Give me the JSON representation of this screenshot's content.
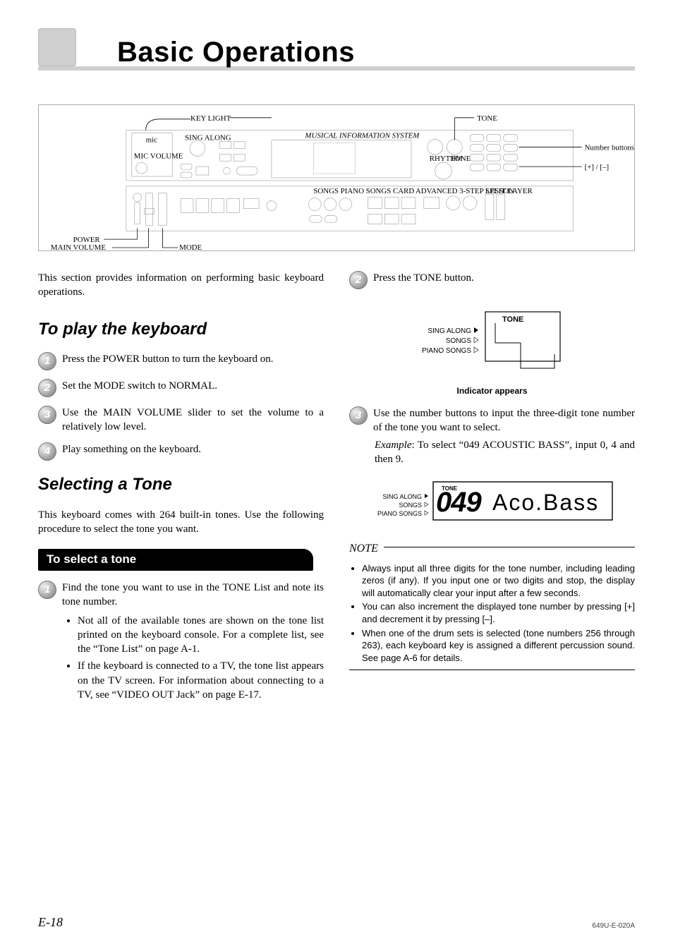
{
  "title": "Basic Operations",
  "intro": "This section provides information on performing basic keyboard operations.",
  "sections": {
    "playKeyboard": {
      "heading": "To play the keyboard",
      "steps": [
        "Press the POWER button to turn the keyboard on.",
        "Set the MODE switch to NORMAL.",
        "Use the MAIN VOLUME slider to set the volume to a relatively low level.",
        "Play something on the keyboard."
      ]
    },
    "selectingTone": {
      "heading": "Selecting a Tone",
      "intro": "This keyboard comes with 264 built-in tones. Use the following procedure to select the tone you want.",
      "subhead": "To select a tone",
      "step1": "Find the tone you want to use in the TONE List and note its tone number.",
      "step1_bullets": [
        "Not all of the available tones are shown on the tone list printed on the keyboard console. For a complete list, see the “Tone List” on page A-1.",
        "If the keyboard is connected to a TV, the tone list appears on the TV screen. For information about connecting to a TV, see “VIDEO OUT Jack” on page E-17."
      ],
      "step2": "Press the TONE button.",
      "indicator_caption": "Indicator appears",
      "step3": "Use the number buttons to input the three-digit tone number of the tone you want to select.",
      "step3_example_label": "Example",
      "step3_example_text": ": To select “049 ACOUSTIC BASS”, input 0, 4 and then 9."
    }
  },
  "diagram": {
    "labels": {
      "keylight": "KEY LIGHT",
      "tone": "TONE",
      "number_buttons": "Number buttons",
      "plus_minus": "[+] / [–]",
      "power": "POWER",
      "main_volume": "MAIN VOLUME",
      "mode": "MODE",
      "mic": "mic",
      "mic_volume": "MIC VOLUME",
      "mis": "MUSICAL INFORMATION SYSTEM",
      "rhythm": "RHYTHM",
      "tone_small": "TONE",
      "sing_along_main": "SING ALONG",
      "songs_piano": "SONGS  PIANO SONGS  CARD",
      "advanced": "ADVANCED 3-STEP LESSON",
      "split_layer": "SPLIT  LAYER"
    },
    "lcd_labels": {
      "sing_along": "SING ALONG",
      "songs": "SONGS",
      "piano_songs": "PIANO SONGS",
      "tone_small": "TONE"
    },
    "lcd_value": "049",
    "lcd_text": "Aco.Bass"
  },
  "note": {
    "heading": "NOTE",
    "items": [
      "Always input all three digits for the tone number, including leading zeros (if any). If you input one or two digits and stop, the display will automatically clear your input after a few seconds.",
      "You can also increment the displayed tone number by pressing [+] and decrement it by pressing [–].",
      "When one of the drum sets is selected (tone numbers 256 through 263), each keyboard key is assigned a different percussion sound. See page A-6 for details."
    ]
  },
  "footer": {
    "page": "E-18",
    "doc": "649U-E-020A"
  }
}
